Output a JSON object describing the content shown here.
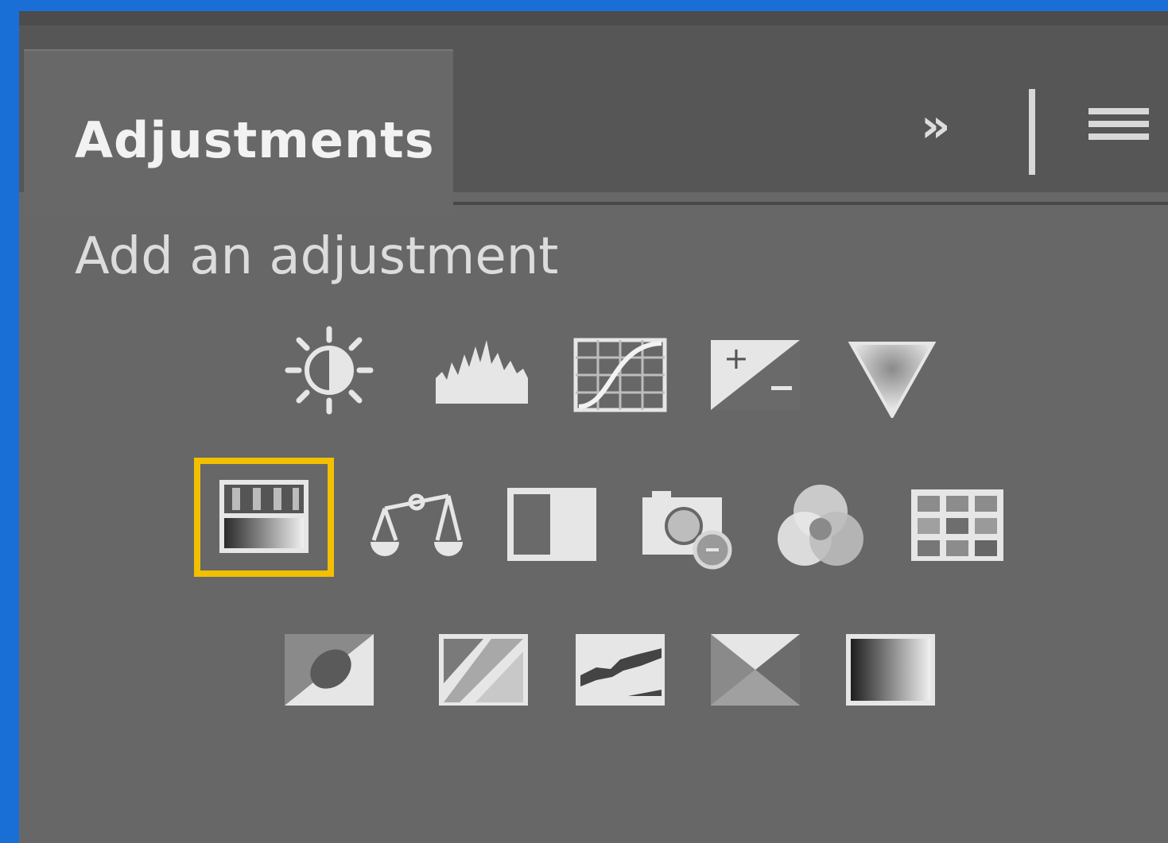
{
  "tab": {
    "label": "Adjustments"
  },
  "header": {
    "subtitle": "Add an adjustment"
  },
  "controls": {
    "expand_glyph": "»",
    "menu_icon": "hamburger-menu-icon"
  },
  "adjustments": [
    {
      "icon": "brightness-contrast-icon"
    },
    {
      "icon": "levels-icon"
    },
    {
      "icon": "curves-icon"
    },
    {
      "icon": "exposure-icon"
    },
    {
      "icon": "vibrance-icon"
    },
    {
      "icon": "hue-saturation-icon",
      "selected": true
    },
    {
      "icon": "color-balance-icon"
    },
    {
      "icon": "black-white-icon"
    },
    {
      "icon": "photo-filter-icon"
    },
    {
      "icon": "channel-mixer-icon"
    },
    {
      "icon": "color-lookup-icon"
    },
    {
      "icon": "invert-icon"
    },
    {
      "icon": "posterize-icon"
    },
    {
      "icon": "threshold-icon"
    },
    {
      "icon": "selective-color-icon"
    },
    {
      "icon": "gradient-map-icon"
    }
  ],
  "colors": {
    "panel": "#676767",
    "tabbar": "#565656",
    "border": "#1a6fd6",
    "highlight": "#f2c000",
    "icon": "#e6e6e6"
  }
}
